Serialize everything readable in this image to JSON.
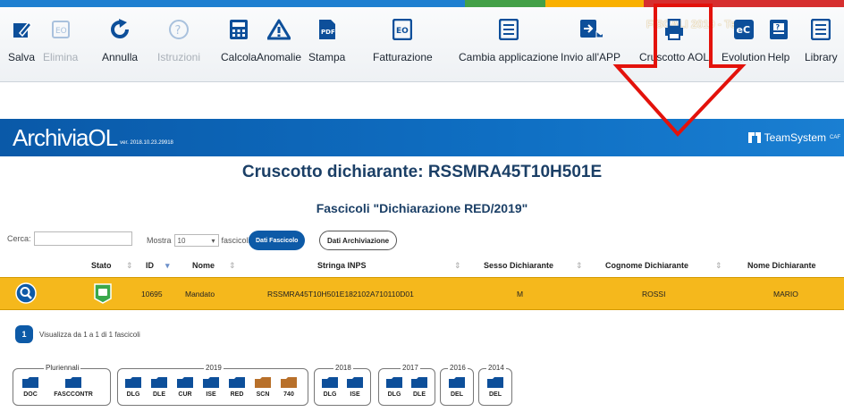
{
  "top_bar_label": "FISCALI 2019 - Test",
  "toolbar": {
    "buttons": [
      {
        "label": "Salva",
        "icon": "edit-icon",
        "enabled": true
      },
      {
        "label": "Elimina",
        "icon": "delete-form-icon",
        "enabled": false
      },
      {
        "label": "Annulla",
        "icon": "undo-icon",
        "enabled": true
      },
      {
        "label": "Istruzioni",
        "icon": "help-circle-icon",
        "enabled": false
      },
      {
        "label": "Calcola",
        "icon": "calculator-icon",
        "enabled": true
      },
      {
        "label": "Anomalie",
        "icon": "warning-icon",
        "enabled": true
      },
      {
        "label": "Stampa",
        "icon": "pdf-icon",
        "enabled": true
      },
      {
        "label": "Fatturazione",
        "icon": "invoice-icon",
        "enabled": true
      },
      {
        "label": "Cambia applicazione",
        "icon": "switch-app-icon",
        "enabled": true
      },
      {
        "label": "Invio all'APP",
        "icon": "send-app-icon",
        "enabled": true
      },
      {
        "label": "Cruscotto AOL",
        "icon": "printer-icon",
        "enabled": true
      },
      {
        "label": "Evolution",
        "icon": "evolution-icon",
        "enabled": true
      },
      {
        "label": "Help",
        "icon": "help-book-icon",
        "enabled": true
      },
      {
        "label": "Library",
        "icon": "library-icon",
        "enabled": true
      }
    ]
  },
  "banner": {
    "brand": "ArchiviaOL",
    "version": "ver. 2018.10.23.29918",
    "partner": "TeamSystem",
    "partner_suffix": "CAF"
  },
  "page_title": "Cruscotto dichiarante: RSSMRA45T10H501E",
  "section_title": "Fascicoli \"Dichiarazione RED/2019\"",
  "controls": {
    "search_label": "Cerca:",
    "search_value": "",
    "show_prefix": "Mostra",
    "show_value": "10",
    "show_suffix": "fascicoli",
    "btn_dati_fascicolo": "Dati Fascicolo",
    "btn_dati_archiviazione": "Dati Archiviazione"
  },
  "table": {
    "headers": [
      "Stato",
      "ID",
      "Nome",
      "Stringa INPS",
      "Sesso Dichiarante",
      "Cognome Dichiarante",
      "Nome Dichiarante"
    ],
    "rows": [
      {
        "id": "10695",
        "nome": "Mandato",
        "stringa": "RSSMRA45T10H501E182102A710110D01",
        "sesso": "M",
        "cognome": "ROSSI",
        "nome_dich": "MARIO"
      }
    ]
  },
  "pagination": {
    "page": "1",
    "info": "Visualizza da 1 a 1 di 1 fascicoli"
  },
  "groups": [
    {
      "title": "Pluriennali",
      "items": [
        "DOC",
        "FASCCONTR"
      ]
    },
    {
      "title": "2019",
      "items": [
        "DLG",
        "DLE",
        "CUR",
        "ISE",
        "RED",
        "SCN",
        "740"
      ]
    },
    {
      "title": "2018",
      "items": [
        "DLG",
        "ISE"
      ]
    },
    {
      "title": "2017",
      "items": [
        "DLG",
        "DLE"
      ]
    },
    {
      "title": "2016",
      "items": [
        "DEL"
      ]
    },
    {
      "title": "2014",
      "items": [
        "DEL"
      ]
    }
  ],
  "colors": {
    "primary": "#0d5aa7",
    "row_highlight": "#f5b81c",
    "annotation": "#e3120b",
    "folder": "#0d4f9a",
    "folder_special": "#b8702a"
  }
}
